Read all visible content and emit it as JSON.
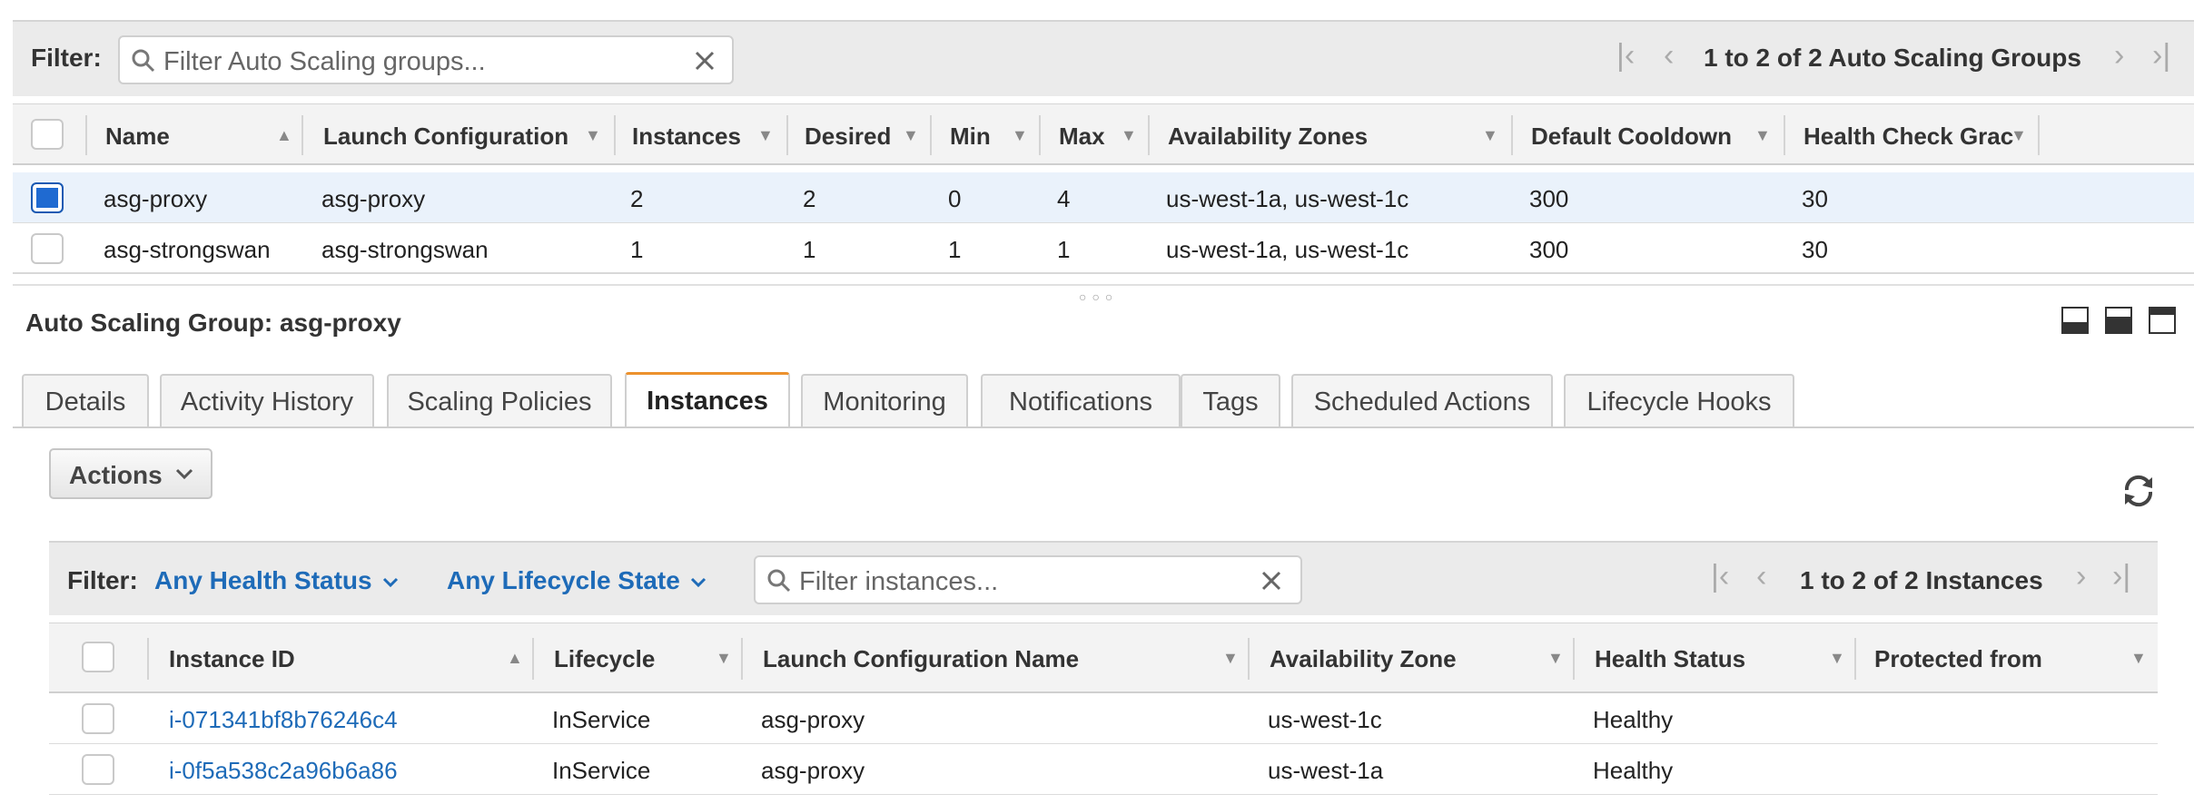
{
  "asg_toolbar": {
    "filter_label": "Filter:",
    "search_placeholder": "Filter Auto Scaling groups...",
    "pager_text": "1 to 2 of 2 Auto Scaling Groups"
  },
  "asg_table": {
    "columns": [
      "Name",
      "Launch Configuration",
      "Instances",
      "Desired",
      "Min",
      "Max",
      "Availability Zones",
      "Default Cooldown",
      "Health Check Grac"
    ],
    "rows": [
      {
        "name": "asg-proxy",
        "launch_config": "asg-proxy",
        "instances": "2",
        "desired": "2",
        "min": "0",
        "max": "4",
        "zones": "us-west-1a, us-west-1c",
        "cooldown": "300",
        "grace": "30",
        "selected": true
      },
      {
        "name": "asg-strongswan",
        "launch_config": "asg-strongswan",
        "instances": "1",
        "desired": "1",
        "min": "1",
        "max": "1",
        "zones": "us-west-1a, us-west-1c",
        "cooldown": "300",
        "grace": "30",
        "selected": false
      }
    ]
  },
  "details": {
    "title": "Auto Scaling Group: asg-proxy",
    "tabs": [
      "Details",
      "Activity History",
      "Scaling Policies",
      "Instances",
      "Monitoring",
      "Notifications",
      "Tags",
      "Scheduled Actions",
      "Lifecycle Hooks"
    ],
    "active_tab": "Instances",
    "actions_label": "Actions"
  },
  "instances_toolbar": {
    "filter_label": "Filter:",
    "health_filter": "Any Health Status",
    "lifecycle_filter": "Any Lifecycle State",
    "search_placeholder": "Filter instances...",
    "pager_text": "1 to 2 of 2 Instances"
  },
  "instances_table": {
    "columns": [
      "Instance ID",
      "Lifecycle",
      "Launch Configuration Name",
      "Availability Zone",
      "Health Status",
      "Protected from"
    ],
    "rows": [
      {
        "id": "i-071341bf8b76246c4",
        "lifecycle": "InService",
        "launch_config": "asg-proxy",
        "zone": "us-west-1c",
        "health": "Healthy"
      },
      {
        "id": "i-0f5a538c2a96b6a86",
        "lifecycle": "InService",
        "launch_config": "asg-proxy",
        "zone": "us-west-1a",
        "health": "Healthy"
      }
    ]
  },
  "icons": [
    "search-icon",
    "clear-icon",
    "first-page-icon",
    "prev-page-icon",
    "next-page-icon",
    "last-page-icon",
    "sort-asc-icon",
    "dropdown-caret-icon",
    "panel-layout-icon",
    "refresh-icon",
    "chevron-down-icon"
  ],
  "colors": {
    "accent_tab": "#ec912d",
    "link": "#1e6bb8",
    "selected_row": "#eaf2fb",
    "checkbox_checked": "#1f6ad1"
  }
}
